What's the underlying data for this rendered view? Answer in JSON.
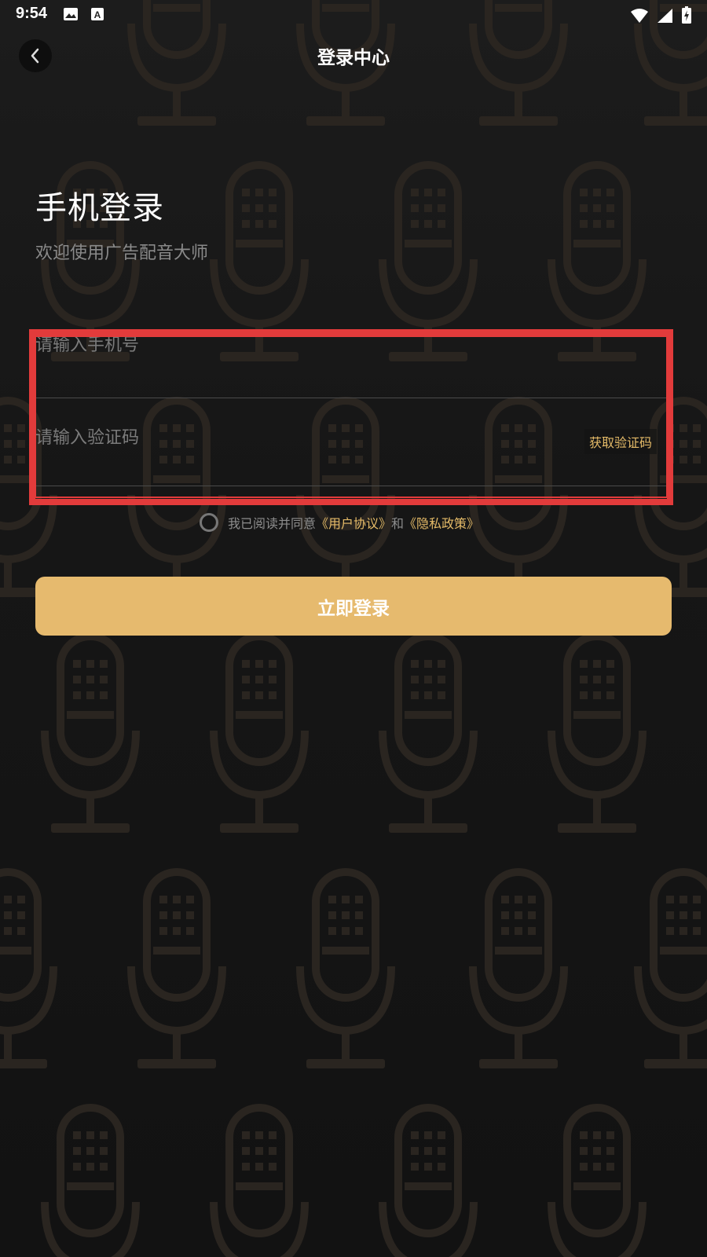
{
  "status_bar": {
    "time": "9:54",
    "left_icons": [
      "image-icon",
      "app-a-icon"
    ],
    "right_icons": [
      "wifi-icon",
      "signal-icon",
      "battery-icon"
    ]
  },
  "header": {
    "back_icon": "chevron-left-icon",
    "title": "登录中心"
  },
  "login": {
    "heading": "手机登录",
    "subtitle": "欢迎使用广告配音大师",
    "phone_placeholder": "请输入手机号",
    "code_placeholder": "请输入验证码",
    "get_code_label": "获取验证码",
    "agreement": {
      "prefix": "我已阅读并同意",
      "user_agreement": "《用户协议》",
      "conjunction": "和",
      "privacy_policy": "《隐私政策》"
    },
    "submit_label": "立即登录"
  },
  "colors": {
    "accent": "#e6ba6e",
    "link": "#e5bb68",
    "highlight": "#e23b3b",
    "background": "#141414"
  }
}
